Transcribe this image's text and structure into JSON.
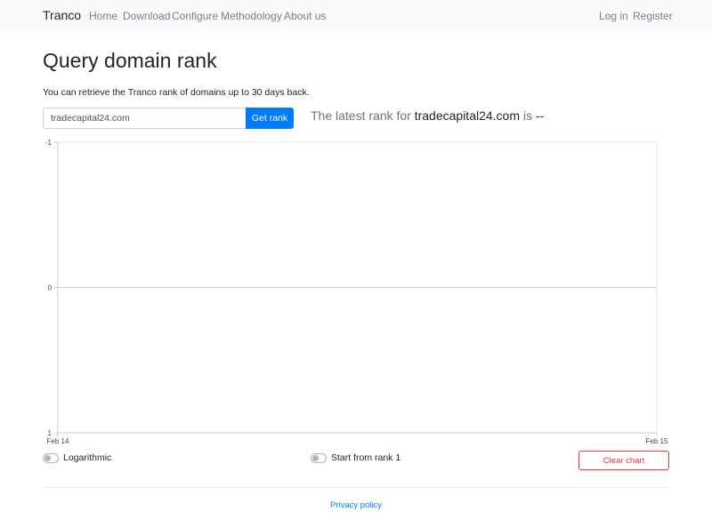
{
  "navbar": {
    "brand": "Tranco",
    "links": [
      "Home",
      "Download",
      "Configure",
      "Methodology",
      "About us"
    ],
    "login": "Log in",
    "register": "Register"
  },
  "main": {
    "title": "Query domain rank",
    "description": "You can retrieve the Tranco rank of domains up to 30 days back.",
    "domain_input": "tradecapital24.com",
    "get_rank_label": "Get rank",
    "latest_prefix": "The latest rank for",
    "latest_domain": "tradecapital24.com",
    "latest_is": "is",
    "latest_rank": "--"
  },
  "chart_data": {
    "type": "line",
    "x_ticks": [
      "Feb 14",
      "Feb 15"
    ],
    "y_ticks": [
      "-1",
      "0",
      "1"
    ],
    "ylim": [
      -1,
      1
    ],
    "series": [],
    "grid": false
  },
  "controls": {
    "logarithmic_label": "Logarithmic",
    "start_rank_label": "Start from rank 1",
    "clear_label": "Clear chart"
  },
  "footer": {
    "privacy_label": "Privacy policy"
  },
  "colors": {
    "primary": "#007bff",
    "danger": "#dc3545",
    "navbar_bg": "#f8f9fa"
  }
}
